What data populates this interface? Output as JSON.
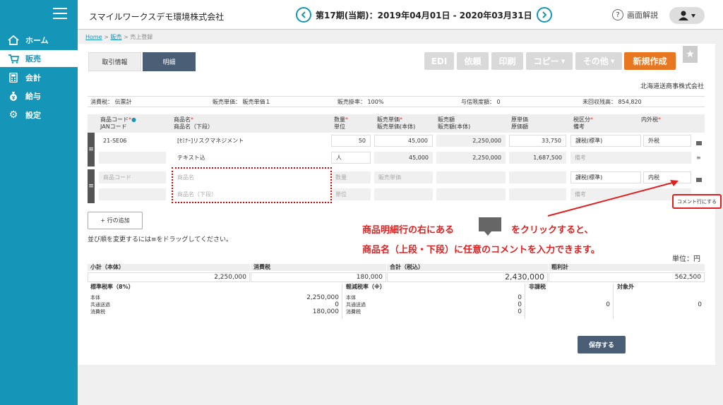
{
  "sidebar": {
    "items": [
      {
        "label": "ホーム",
        "icon": "home-icon"
      },
      {
        "label": "販売",
        "icon": "cart-icon"
      },
      {
        "label": "会計",
        "icon": "calculator-icon"
      },
      {
        "label": "給与",
        "icon": "money-bag-icon"
      },
      {
        "label": "設定",
        "icon": "gear-icon"
      }
    ],
    "active_index": 1
  },
  "header": {
    "company": "スマイルワークスデモ環境株式会社",
    "period": "第17期(当期)：2019年04月01日 - 2020年03月31日",
    "help_label": "画面解説"
  },
  "breadcrumb": {
    "home": "Home",
    "sales": "販売",
    "current": "売上登録"
  },
  "tabs": {
    "info": "取引情報",
    "detail": "明細"
  },
  "toolbar": {
    "edi": "EDI",
    "request": "依頼",
    "print": "印刷",
    "copy": "コピー",
    "other": "その他",
    "new": "新規作成"
  },
  "customer": "北海道送商事株式会社",
  "info_row": {
    "tax_label": "消費税：",
    "tax_value": "伝票計",
    "unit_price_label": "販売単価：",
    "unit_price_value": "販売単価１",
    "rate_label": "販売掛率：",
    "rate_value": "100%",
    "credit_label": "与信限度額：",
    "credit_value": "0",
    "unpaid_label": "未回収残高：",
    "unpaid_value": "854,820"
  },
  "table_headers": {
    "code": "商品コード",
    "jan": "JANコード",
    "name": "商品名",
    "name_lower": "商品名（下段）",
    "qty": "数量",
    "unit": "単位",
    "price": "販売単価",
    "price_body": "販売単価(本体)",
    "amount": "販売額",
    "amount_body": "販売額(本体)",
    "cost": "原単価",
    "cost_amount": "原価額",
    "tax_class": "税区分",
    "memo": "備考",
    "inout": "内外税"
  },
  "row1": {
    "code": "21-SE06",
    "name": "[ｾﾐﾅｰ]リスクマネジメント",
    "name_lower": "テキスト込",
    "qty": "50",
    "unit": "人",
    "price": "45,000",
    "price_body": "45,000",
    "amount": "2,250,000",
    "amount_body": "2,250,000",
    "cost": "33,750",
    "cost_amount": "1,687,500",
    "tax_class": "課税(標準)",
    "inout": "外税",
    "memo_placeholder": "備考"
  },
  "row2": {
    "code_placeholder": "商品コード",
    "name_placeholder": "商品名",
    "name_lower_placeholder": "商品名（下段）",
    "qty_placeholder": "数量",
    "unit_placeholder": "単位",
    "price_placeholder": "販売単価",
    "tax_class": "課税(標準)",
    "inout": "内税",
    "memo_placeholder": "備考"
  },
  "add_row": "+ 行の追加",
  "drag_note": "並び順を変更するには≡をドラッグしてください。",
  "annotation": {
    "line1a": "商品明細行の右にある",
    "line1b": "をクリックすると、",
    "line2": "商品名（上段・下段）に任意のコメントを入力できます。",
    "comment_label": "コメント行にする"
  },
  "unit_label": "単位：円",
  "summary": {
    "subtotal_label": "小計（本体）",
    "subtotal": "2,250,000",
    "tax_label": "消費税",
    "tax": "180,000",
    "total_label": "合計（税込）",
    "total": "2,430,000",
    "gross_label": "粗利計",
    "gross": "562,500"
  },
  "tax_boxes": {
    "standard": {
      "title": "標準税率（8%）",
      "body_label": "本体",
      "body": "2,250,000",
      "ship_label": "共通送過",
      "ship": "0",
      "tax_label": "消費税",
      "tax": "180,000"
    },
    "reduced": {
      "title": "軽減税率（※）",
      "body_label": "本体",
      "body": "0",
      "ship_label": "共通送過",
      "ship": "0",
      "tax_label": "消費税",
      "tax": "0"
    },
    "exempt": {
      "title": "非課税",
      "value": "0"
    },
    "outside": {
      "title": "対象外",
      "value": "0"
    }
  },
  "save_button": "保存する"
}
